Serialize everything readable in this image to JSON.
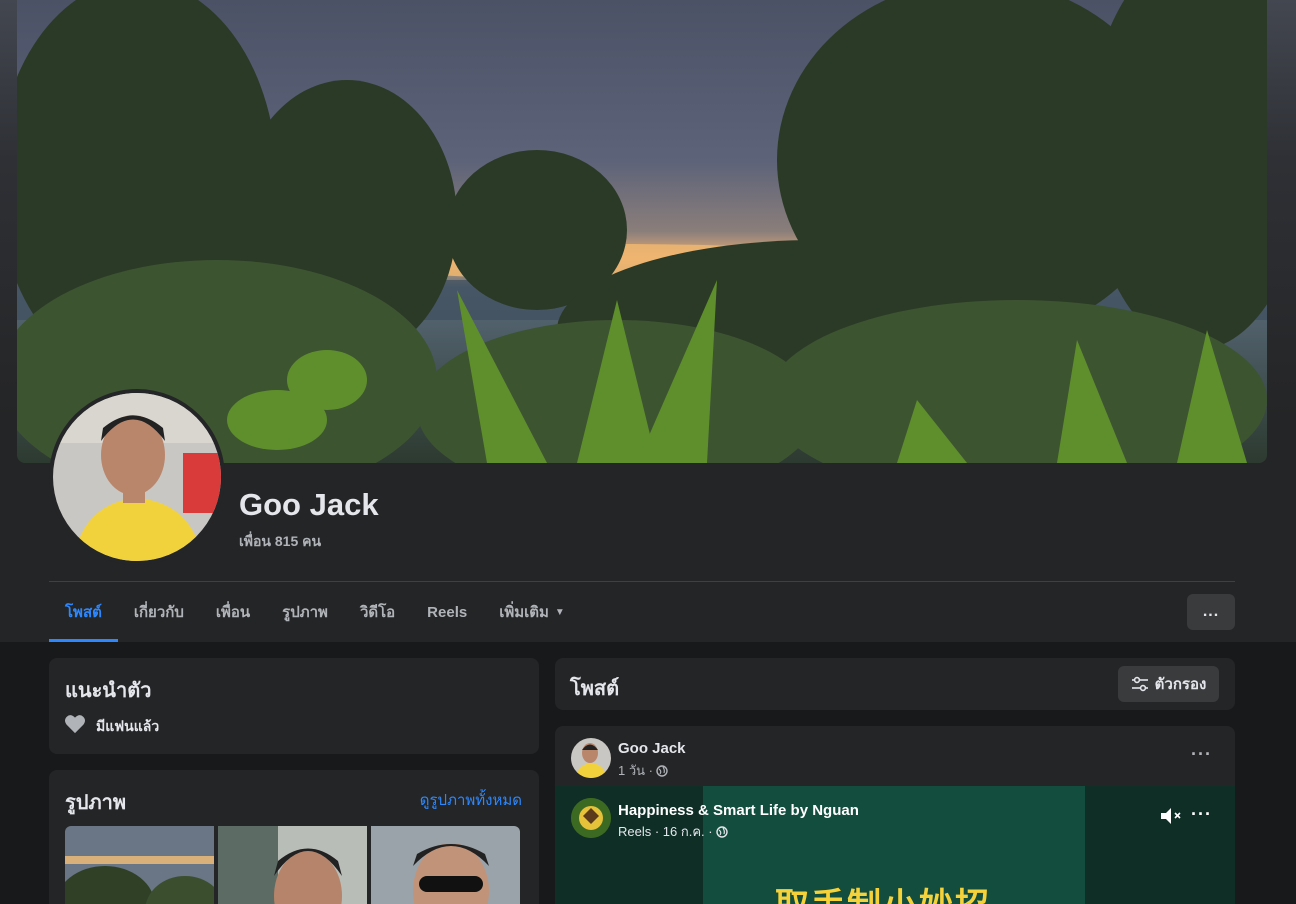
{
  "profile": {
    "name": "Goo Jack",
    "friends_count": "เพื่อน 815 คน"
  },
  "tabs": [
    {
      "label": "โพสต์",
      "active": true
    },
    {
      "label": "เกี่ยวกับ"
    },
    {
      "label": "เพื่อน"
    },
    {
      "label": "รูปภาพ"
    },
    {
      "label": "วิดีโอ"
    },
    {
      "label": "Reels"
    },
    {
      "label": "เพิ่มเติม"
    }
  ],
  "more_icon": "...",
  "intro": {
    "title": "แนะนำตัว",
    "relationship": "มีแฟนแล้ว",
    "relationship_icon": "heart-icon"
  },
  "photos": {
    "title": "รูปภาพ",
    "see_all": "ดูรูปภาพทั้งหมด"
  },
  "posts": {
    "title": "โพสต์",
    "filter_label": "ตัวกรอง"
  },
  "post": {
    "author": "Goo Jack",
    "time": "1 วัน ·",
    "shared_reel": {
      "author": "Happiness & Smart Life by Nguan",
      "meta": "Reels · 16 ก.ค. ·",
      "caption_partial": "取手制小妙招"
    }
  },
  "colors": {
    "accent": "#2d88ff",
    "background": "#18191a",
    "card": "#242526"
  }
}
